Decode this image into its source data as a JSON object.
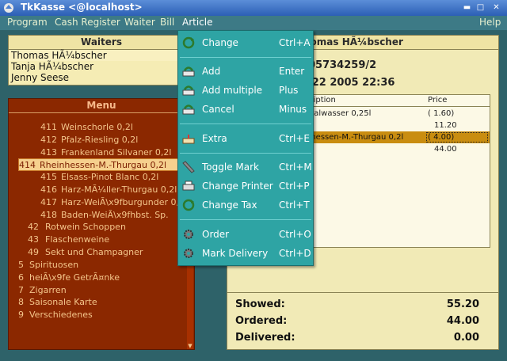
{
  "window": {
    "title": "TkKasse <@localhost>"
  },
  "menubar": {
    "items": [
      {
        "label": "Program",
        "u": "P"
      },
      {
        "label": "Cash Register",
        "u": "s"
      },
      {
        "label": "Waiter",
        "u": "W"
      },
      {
        "label": "Bill",
        "u": "B"
      },
      {
        "label": "Article",
        "u": "A"
      },
      {
        "label": "Help",
        "u": "H"
      }
    ]
  },
  "waiters": {
    "title": "Waiters",
    "list": [
      "Thomas HÃ¼bscher",
      "Tanja HÃ¼bscher",
      "Jenny Seese"
    ]
  },
  "menu": {
    "title": "Menu",
    "rows": [
      {
        "num": "411",
        "name": "Weinschorle 0,2l"
      },
      {
        "num": "412",
        "name": "Pfalz-Riesling 0,2l"
      },
      {
        "num": "413",
        "name": "Frankenland Silvaner 0,2l"
      },
      {
        "num": "414",
        "name": "Rheinhessen-M.-Thurgau 0,2l"
      },
      {
        "num": "415",
        "name": "Elsass-Pinot Blanc 0,2l"
      },
      {
        "num": "416",
        "name": "Harz-MÃ¼ller-Thurgau 0,2l"
      },
      {
        "num": "417",
        "name": "Harz-WeiÃ\\x9fburgunder 0,2l"
      },
      {
        "num": "418",
        "name": "Baden-WeiÃ\\x9fhbst. Sp."
      },
      {
        "num": "42",
        "name": "Rotwein Schoppen"
      },
      {
        "num": "43",
        "name": "Flaschenweine"
      },
      {
        "num": "49",
        "name": "Sekt und Champagner"
      },
      {
        "num": "5",
        "name": "Spirituosen"
      },
      {
        "num": "6",
        "name": "heiÃ\\x9fe GetrÃ¤nke"
      },
      {
        "num": "7",
        "name": "Zigarren"
      },
      {
        "num": "8",
        "name": "Saisonale Karte"
      },
      {
        "num": "9",
        "name": "Verschiedenes"
      }
    ]
  },
  "bill": {
    "waiter": "homas HÃ¼bscher",
    "number": "05734259/2",
    "date": "/22 2005 22:36",
    "col_desc": "cription",
    "col_price": "Price",
    "rows": [
      {
        "desc": "eralwasser 0,25l",
        "price": "( 1.60)"
      },
      {
        "desc": "",
        "price": "11.20"
      },
      {
        "desc": "nhessen-M.-Thurgau 0,2l",
        "price": "( 4.00)"
      },
      {
        "desc": "",
        "price": "44.00"
      }
    ]
  },
  "totals": {
    "showed_label": "Showed:",
    "showed": "55.20",
    "ordered_label": "Ordered:",
    "ordered": "44.00",
    "delivered_label": "Delivered:",
    "delivered": "0.00"
  },
  "article_menu": {
    "items": [
      {
        "label": "Change",
        "shortcut": "Ctrl+A",
        "icon": "change-icon"
      },
      {
        "label": "Add",
        "shortcut": "Enter",
        "icon": "add-icon"
      },
      {
        "label": "Add multiple",
        "shortcut": "Plus",
        "icon": "add-multiple-icon"
      },
      {
        "label": "Cancel",
        "shortcut": "Minus",
        "icon": "cancel-icon"
      },
      {
        "label": "Extra",
        "shortcut": "Ctrl+E",
        "icon": "cake-icon"
      },
      {
        "label": "Toggle Mark",
        "shortcut": "Ctrl+M",
        "icon": "pen-icon"
      },
      {
        "label": "Change Printer",
        "shortcut": "Ctrl+P",
        "icon": "printer-icon"
      },
      {
        "label": "Change Tax",
        "shortcut": "Ctrl+T",
        "icon": "change-icon"
      },
      {
        "label": "Order",
        "shortcut": "Ctrl+O",
        "icon": "gear-icon"
      },
      {
        "label": "Mark Delivery",
        "shortcut": "Ctrl+D",
        "icon": "gear-icon"
      }
    ]
  }
}
